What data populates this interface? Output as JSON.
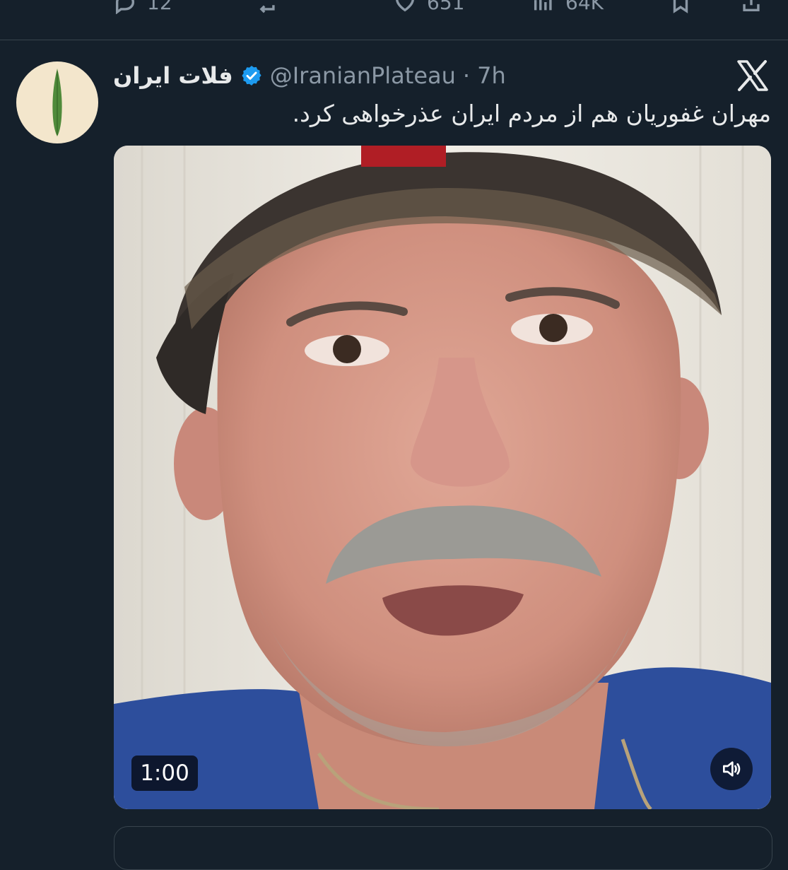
{
  "previous_tweet": {
    "reply_count": "12",
    "like_count": "651",
    "view_count": "64K"
  },
  "tweet": {
    "display_name": "فلات ایران",
    "handle": "@IranianPlateau",
    "separator": "·",
    "time": "7h",
    "text": "مهران غفوریان هم از مردم ایران عذرخواهی کرد.",
    "verified": true,
    "avatar_icon": "cypress-tree-icon"
  },
  "media": {
    "type": "video",
    "duration": "1:00",
    "volume_icon": "speaker-icon"
  },
  "colors": {
    "background": "#15202b",
    "text": "#e7e9ea",
    "muted": "#8b98a5",
    "verified": "#1d9bf0",
    "divider": "#38444d"
  }
}
